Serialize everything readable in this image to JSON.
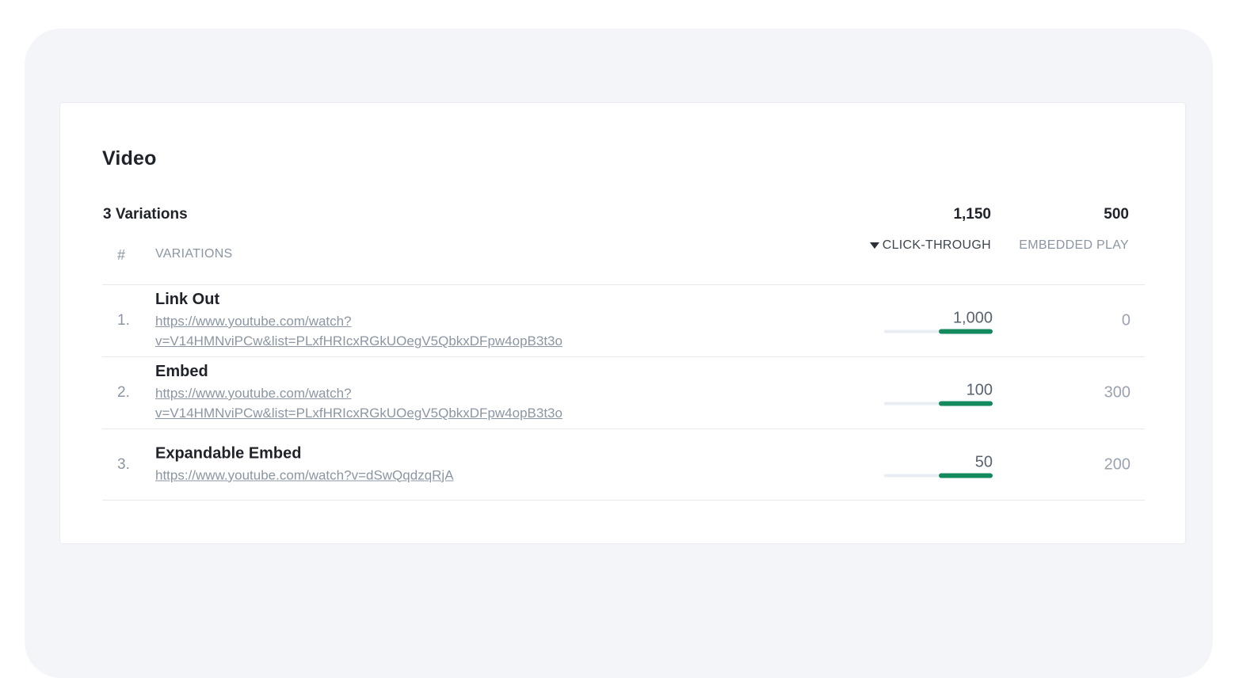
{
  "section": {
    "title": "Video"
  },
  "summary": {
    "label": "3 Variations",
    "click_through_total": "1,150",
    "embedded_play_total": "500"
  },
  "columns": {
    "number": "#",
    "variations": "VARIATIONS",
    "click_through": "CLICK-THROUGH",
    "embedded_play": "EMBEDDED PLAY"
  },
  "colors": {
    "bar_fill": "#138a5e",
    "bar_track": "#e8edf3"
  },
  "rows": [
    {
      "number": "1.",
      "name": "Link Out",
      "url_lines": [
        "https://www.youtube.com/watch?",
        "v=V14HMNviPCw&list=PLxfHRIcxRGkUOegV5QbkxDFpw4opB3t3o"
      ],
      "click_through": "1,000",
      "click_through_share": 0.5,
      "embedded_play": "0"
    },
    {
      "number": "2.",
      "name": "Embed",
      "url_lines": [
        "https://www.youtube.com/watch?",
        "v=V14HMNviPCw&list=PLxfHRIcxRGkUOegV5QbkxDFpw4opB3t3o"
      ],
      "click_through": "100",
      "click_through_share": 0.5,
      "embedded_play": "300"
    },
    {
      "number": "3.",
      "name": "Expandable Embed",
      "url_lines": [
        "https://www.youtube.com/watch?v=dSwQqdzqRjA"
      ],
      "click_through": "50",
      "click_through_share": 0.5,
      "embedded_play": "200"
    }
  ]
}
